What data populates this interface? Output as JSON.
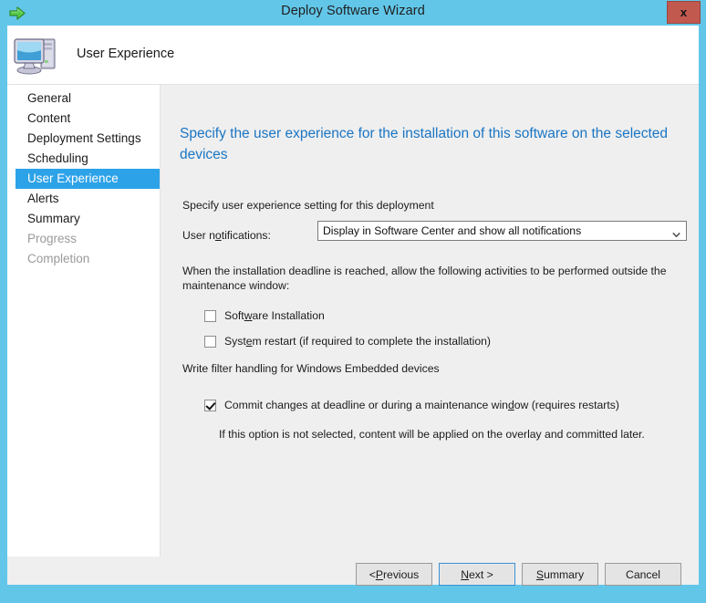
{
  "window": {
    "title": "Deploy Software Wizard",
    "title_icon": "green-arrow-icon",
    "close_label": "x",
    "titlebar_color": "#62c6e8",
    "close_color": "#c1594f"
  },
  "header": {
    "title": "User Experience",
    "icon": "computer-icon"
  },
  "sidebar": {
    "items": [
      {
        "label": "General",
        "state": "normal"
      },
      {
        "label": "Content",
        "state": "normal"
      },
      {
        "label": "Deployment Settings",
        "state": "normal"
      },
      {
        "label": "Scheduling",
        "state": "normal"
      },
      {
        "label": "User Experience",
        "state": "selected"
      },
      {
        "label": "Alerts",
        "state": "normal"
      },
      {
        "label": "Summary",
        "state": "normal"
      },
      {
        "label": "Progress",
        "state": "disabled"
      },
      {
        "label": "Completion",
        "state": "disabled"
      }
    ],
    "selected_color": "#2ca2e8",
    "disabled_color": "#9a9a9a"
  },
  "content": {
    "heading": "Specify the user experience for the installation of this software on the selected devices",
    "heading_color": "#1a75c4",
    "setting_label": "Specify user experience setting for this deployment",
    "notifications_label_prefix": "User n",
    "notifications_label_accel": "o",
    "notifications_label_suffix": "tifications:",
    "notifications_value": "Display in Software Center and show all notifications",
    "deadline_text": "When the installation deadline is reached, allow the following activities to be performed outside the maintenance window:",
    "checkbox_software": {
      "prefix": "Soft",
      "accel": "w",
      "suffix": "are Installation",
      "checked": false
    },
    "checkbox_restart": {
      "prefix": "Syst",
      "accel": "e",
      "suffix": "m restart  (if required to complete the installation)",
      "checked": false
    },
    "writefilter_label": "Write filter handling for Windows Embedded devices",
    "checkbox_commit": {
      "prefix": "Commit changes at deadline or during a maintenance win",
      "accel": "d",
      "suffix": "ow (requires restarts)",
      "checked": true
    },
    "hint_text": "If this option is not selected, content will be applied on the overlay and committed later."
  },
  "buttons": {
    "previous": {
      "prefix": "< ",
      "accel": "P",
      "suffix": "revious",
      "focused": false
    },
    "next": {
      "prefix": "",
      "accel": "N",
      "suffix": "ext >",
      "focused": true
    },
    "summary": {
      "prefix": "",
      "accel": "S",
      "suffix": "ummary",
      "focused": false
    },
    "cancel": {
      "prefix": "Cancel",
      "accel": "",
      "suffix": "",
      "focused": false
    }
  }
}
